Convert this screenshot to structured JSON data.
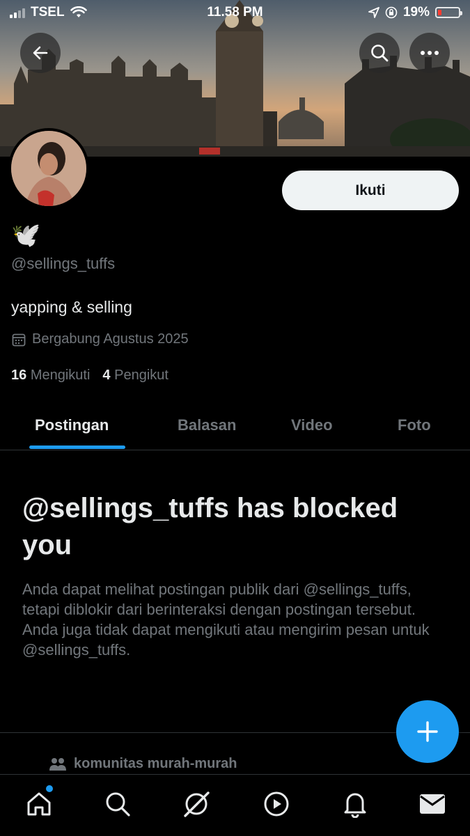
{
  "status_bar": {
    "carrier": "TSEL",
    "time": "11.58 PM",
    "battery": "19%",
    "battery_level": 0.19
  },
  "header": {
    "back_icon": "arrow-left-icon",
    "search_icon": "search-icon",
    "more_icon": "more-horizontal-icon"
  },
  "profile": {
    "display_name": "🕊️",
    "handle": "@sellings_tuffs",
    "bio": "yapping & selling",
    "joined": "Bergabung Agustus 2025",
    "following_count": "16",
    "following_label": "Mengikuti",
    "followers_count": "4",
    "followers_label": "Pengikut",
    "follow_button": "Ikuti"
  },
  "tabs": [
    {
      "label": "Postingan",
      "active": true
    },
    {
      "label": "Balasan",
      "active": false
    },
    {
      "label": "Video",
      "active": false
    },
    {
      "label": "Foto",
      "active": false
    }
  ],
  "blocked": {
    "title": "@sellings_tuffs has blocked you",
    "description": "Anda dapat melihat postingan publik dari @sellings_tuffs, tetapi diblokir dari berinteraksi dengan postingan tersebut. Anda juga tidak dapat mengikuti atau mengirim pesan untuk @sellings_tuffs."
  },
  "community": {
    "label": "komunitas murah-murah"
  },
  "bottom_nav": [
    "home-icon",
    "search-icon",
    "grok-icon",
    "play-icon",
    "bell-icon",
    "mail-icon"
  ],
  "colors": {
    "accent": "#1d9bf0",
    "background": "#000000",
    "text_secondary": "#71767b"
  }
}
